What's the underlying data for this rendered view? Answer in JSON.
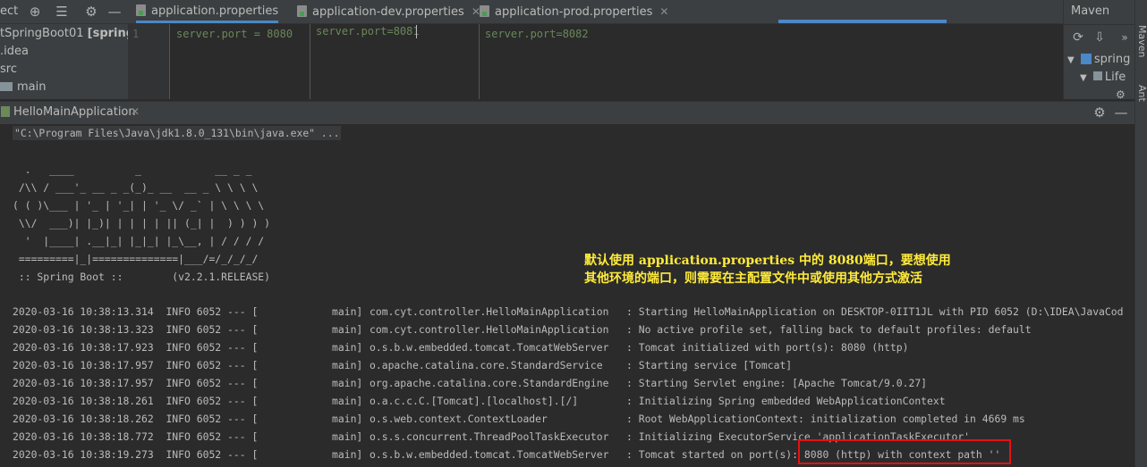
{
  "toolbar": {
    "project_label": "ect",
    "icons": [
      "add-icon",
      "target-icon",
      "collapse-icon",
      "gear-icon",
      "minimize-icon"
    ]
  },
  "project_tree": {
    "root": "tSpringBoot01",
    "root_module": "[spring-",
    "items": [
      ".idea",
      "src",
      "main"
    ]
  },
  "editor": {
    "tabs": [
      {
        "label": "application.properties",
        "active": true
      },
      {
        "label": "application-dev.properties",
        "active": false
      },
      {
        "label": "application-prod.properties",
        "active": false
      }
    ],
    "panes": [
      {
        "line_number": "1",
        "code": "server.port = 8080"
      },
      {
        "code": "server.port=8081"
      },
      {
        "code": "server.port=8082"
      }
    ]
  },
  "maven": {
    "title": "Maven",
    "tree": [
      "spring",
      "Life"
    ],
    "side_labels": [
      "Maven",
      "Ant"
    ]
  },
  "run": {
    "tab_label": "HelloMainApplication",
    "command": "\"C:\\Program Files\\Java\\jdk1.8.0_131\\bin\\java.exe\" ...",
    "banner": [
      "  .   ____          _            __ _ _",
      " /\\\\ / ___'_ __ _ _(_)_ __  __ _ \\ \\ \\ \\",
      "( ( )\\___ | '_ | '_| | '_ \\/ _` | \\ \\ \\ \\",
      " \\\\/  ___)| |_)| | | | | || (_| |  ) ) ) )",
      "  '  |____| .__|_| |_|_| |_\\__, | / / / /",
      " =========|_|==============|___/=/_/_/_/",
      " :: Spring Boot ::        (v2.2.1.RELEASE)"
    ],
    "annotation": [
      "默认使用 application.properties 中的 8080端口，要想使用",
      "其他环境的端口，则需要在主配置文件中或使用其他方式激活"
    ],
    "logs": [
      {
        "prefix": "2020-03-16 10:38:13.314  INFO 6052 --- [",
        "thread": "main]",
        "logger": "com.cyt.controller.HelloMainApplication",
        "message": ": Starting HelloMainApplication on DESKTOP-0IIT1JL with PID 6052 (D:\\IDEA\\JavaCod"
      },
      {
        "prefix": "2020-03-16 10:38:13.323  INFO 6052 --- [",
        "thread": "main]",
        "logger": "com.cyt.controller.HelloMainApplication",
        "message": ": No active profile set, falling back to default profiles: default"
      },
      {
        "prefix": "2020-03-16 10:38:17.923  INFO 6052 --- [",
        "thread": "main]",
        "logger": "o.s.b.w.embedded.tomcat.TomcatWebServer",
        "message": ": Tomcat initialized with port(s): 8080 (http)"
      },
      {
        "prefix": "2020-03-16 10:38:17.957  INFO 6052 --- [",
        "thread": "main]",
        "logger": "o.apache.catalina.core.StandardService",
        "message": ": Starting service [Tomcat]"
      },
      {
        "prefix": "2020-03-16 10:38:17.957  INFO 6052 --- [",
        "thread": "main]",
        "logger": "org.apache.catalina.core.StandardEngine",
        "message": ": Starting Servlet engine: [Apache Tomcat/9.0.27]"
      },
      {
        "prefix": "2020-03-16 10:38:18.261  INFO 6052 --- [",
        "thread": "main]",
        "logger": "o.a.c.c.C.[Tomcat].[localhost].[/]",
        "message": ": Initializing Spring embedded WebApplicationContext"
      },
      {
        "prefix": "2020-03-16 10:38:18.262  INFO 6052 --- [",
        "thread": "main]",
        "logger": "o.s.web.context.ContextLoader",
        "message": ": Root WebApplicationContext: initialization completed in 4669 ms"
      },
      {
        "prefix": "2020-03-16 10:38:18.772  INFO 6052 --- [",
        "thread": "main]",
        "logger": "o.s.s.concurrent.ThreadPoolTaskExecutor",
        "message": ": Initializing ExecutorService 'applicationTaskExecutor'"
      },
      {
        "prefix": "2020-03-16 10:38:19.273  INFO 6052 --- [",
        "thread": "main]",
        "logger": "o.s.b.w.embedded.tomcat.TomcatWebServer",
        "message": ": Tomcat started on port(s): 8080 (http) with context path ''"
      }
    ]
  }
}
